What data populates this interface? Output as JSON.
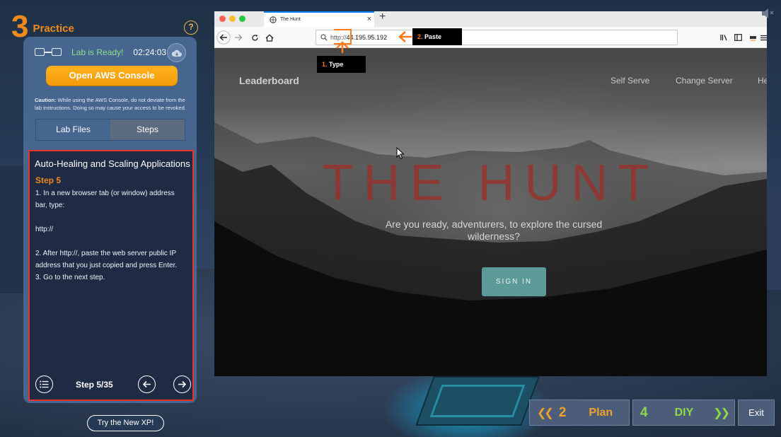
{
  "header": {
    "section_number": "3",
    "section_label": "Practice",
    "help_label": "?"
  },
  "lab_panel": {
    "status": "Lab is Ready!",
    "timer": "02:24:03",
    "open_console_label": "Open AWS Console",
    "caution_prefix": "Caution:",
    "caution_text": " While using the AWS Console, do not deviate from the lab instructions. Doing so may cause your access to be revoked.",
    "tabs": [
      {
        "label": "Lab Files"
      },
      {
        "label": "Steps"
      }
    ],
    "active_tab": "Steps"
  },
  "steps": {
    "title": "Auto-Healing and Scaling Applications",
    "step_heading": "Step 5",
    "lines": [
      "1. In a new browser tab (or window) address bar, type:",
      "",
      "http://",
      "",
      "2. After http://, paste the web server public IP address that you just copied and press Enter.",
      "3. Go to the next step."
    ],
    "counter": "Step 5/35"
  },
  "try_new_xp_label": "Try the New XP!",
  "browser": {
    "tab_title": "The Hunt",
    "url_prefix": "http://",
    "url_host": "44.195.95.192"
  },
  "webpage": {
    "nav_brand": "Leaderboard",
    "nav_links": [
      "Self Serve",
      "Change Server",
      "He"
    ],
    "hero_title": "THE HUNT",
    "hero_subtitle": "Are you ready, adventurers, to explore the cursed wilderness?",
    "signin_label": "SIGN IN"
  },
  "annotations": {
    "type": {
      "num": "1.",
      "label": " Type"
    },
    "paste": {
      "num": "2.",
      "label": " Paste"
    },
    "color": "#ff7a1a"
  },
  "bottom_nav": {
    "plan": {
      "num": "2",
      "label": "Plan"
    },
    "diy": {
      "num": "4",
      "label": "DIY"
    },
    "exit": "Exit"
  },
  "colors": {
    "accent_orange": "#f08a1c",
    "ready_green": "#8fe08e",
    "diy_green": "#8fd64a",
    "highlight_red": "#e8322a"
  }
}
